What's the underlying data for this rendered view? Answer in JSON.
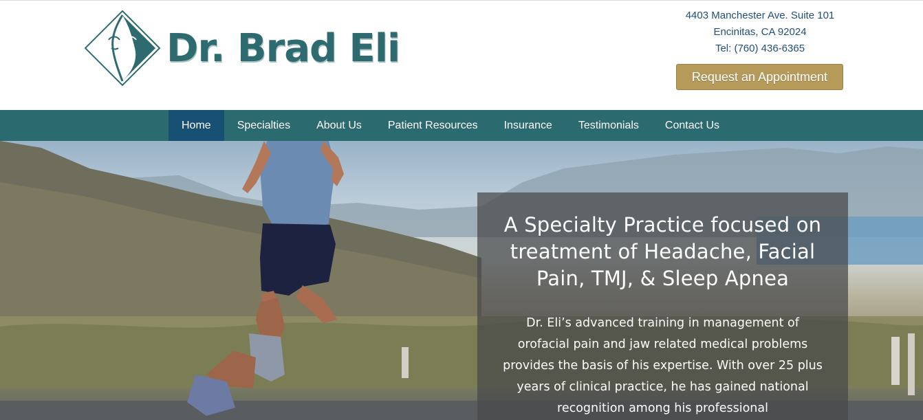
{
  "brand": {
    "name": "Dr. Brad Eli",
    "logo_icon": "face-diamond-logo-icon",
    "color": "#2d6b70"
  },
  "contact": {
    "address_line1": "4403 Manchester Ave. Suite 101",
    "address_line2": "Encinitas, CA 92024",
    "phone": "Tel: (760) 436-6365",
    "appointment_button": "Request an Appointment"
  },
  "nav": {
    "items": [
      {
        "label": "Home",
        "active": true
      },
      {
        "label": "Specialties",
        "active": false
      },
      {
        "label": "About Us",
        "active": false
      },
      {
        "label": "Patient Resources",
        "active": false
      },
      {
        "label": "Insurance",
        "active": false
      },
      {
        "label": "Testimonials",
        "active": false
      },
      {
        "label": "Contact Us",
        "active": false
      }
    ],
    "bar_color": "#2b6a6f",
    "active_color": "#175072"
  },
  "hero": {
    "heading": "A Specialty Practice focused on treatment of Headache, Facial Pain, TMJ, & Sleep Apnea",
    "body": "Dr. Eli’s advanced training in management of orofacial pain and jaw related medical problems provides the basis of his expertise. With over 25 plus years of clinical practice, he has gained national recognition among his professional",
    "image": "runner-on-desert-road-photo"
  }
}
